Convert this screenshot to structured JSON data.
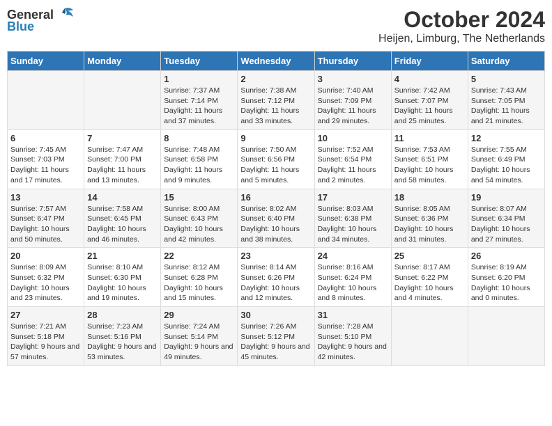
{
  "logo": {
    "general": "General",
    "blue": "Blue"
  },
  "title": "October 2024",
  "location": "Heijen, Limburg, The Netherlands",
  "days_of_week": [
    "Sunday",
    "Monday",
    "Tuesday",
    "Wednesday",
    "Thursday",
    "Friday",
    "Saturday"
  ],
  "weeks": [
    [
      {
        "day": "",
        "info": ""
      },
      {
        "day": "",
        "info": ""
      },
      {
        "day": "1",
        "info": "Sunrise: 7:37 AM\nSunset: 7:14 PM\nDaylight: 11 hours and 37 minutes."
      },
      {
        "day": "2",
        "info": "Sunrise: 7:38 AM\nSunset: 7:12 PM\nDaylight: 11 hours and 33 minutes."
      },
      {
        "day": "3",
        "info": "Sunrise: 7:40 AM\nSunset: 7:09 PM\nDaylight: 11 hours and 29 minutes."
      },
      {
        "day": "4",
        "info": "Sunrise: 7:42 AM\nSunset: 7:07 PM\nDaylight: 11 hours and 25 minutes."
      },
      {
        "day": "5",
        "info": "Sunrise: 7:43 AM\nSunset: 7:05 PM\nDaylight: 11 hours and 21 minutes."
      }
    ],
    [
      {
        "day": "6",
        "info": "Sunrise: 7:45 AM\nSunset: 7:03 PM\nDaylight: 11 hours and 17 minutes."
      },
      {
        "day": "7",
        "info": "Sunrise: 7:47 AM\nSunset: 7:00 PM\nDaylight: 11 hours and 13 minutes."
      },
      {
        "day": "8",
        "info": "Sunrise: 7:48 AM\nSunset: 6:58 PM\nDaylight: 11 hours and 9 minutes."
      },
      {
        "day": "9",
        "info": "Sunrise: 7:50 AM\nSunset: 6:56 PM\nDaylight: 11 hours and 5 minutes."
      },
      {
        "day": "10",
        "info": "Sunrise: 7:52 AM\nSunset: 6:54 PM\nDaylight: 11 hours and 2 minutes."
      },
      {
        "day": "11",
        "info": "Sunrise: 7:53 AM\nSunset: 6:51 PM\nDaylight: 10 hours and 58 minutes."
      },
      {
        "day": "12",
        "info": "Sunrise: 7:55 AM\nSunset: 6:49 PM\nDaylight: 10 hours and 54 minutes."
      }
    ],
    [
      {
        "day": "13",
        "info": "Sunrise: 7:57 AM\nSunset: 6:47 PM\nDaylight: 10 hours and 50 minutes."
      },
      {
        "day": "14",
        "info": "Sunrise: 7:58 AM\nSunset: 6:45 PM\nDaylight: 10 hours and 46 minutes."
      },
      {
        "day": "15",
        "info": "Sunrise: 8:00 AM\nSunset: 6:43 PM\nDaylight: 10 hours and 42 minutes."
      },
      {
        "day": "16",
        "info": "Sunrise: 8:02 AM\nSunset: 6:40 PM\nDaylight: 10 hours and 38 minutes."
      },
      {
        "day": "17",
        "info": "Sunrise: 8:03 AM\nSunset: 6:38 PM\nDaylight: 10 hours and 34 minutes."
      },
      {
        "day": "18",
        "info": "Sunrise: 8:05 AM\nSunset: 6:36 PM\nDaylight: 10 hours and 31 minutes."
      },
      {
        "day": "19",
        "info": "Sunrise: 8:07 AM\nSunset: 6:34 PM\nDaylight: 10 hours and 27 minutes."
      }
    ],
    [
      {
        "day": "20",
        "info": "Sunrise: 8:09 AM\nSunset: 6:32 PM\nDaylight: 10 hours and 23 minutes."
      },
      {
        "day": "21",
        "info": "Sunrise: 8:10 AM\nSunset: 6:30 PM\nDaylight: 10 hours and 19 minutes."
      },
      {
        "day": "22",
        "info": "Sunrise: 8:12 AM\nSunset: 6:28 PM\nDaylight: 10 hours and 15 minutes."
      },
      {
        "day": "23",
        "info": "Sunrise: 8:14 AM\nSunset: 6:26 PM\nDaylight: 10 hours and 12 minutes."
      },
      {
        "day": "24",
        "info": "Sunrise: 8:16 AM\nSunset: 6:24 PM\nDaylight: 10 hours and 8 minutes."
      },
      {
        "day": "25",
        "info": "Sunrise: 8:17 AM\nSunset: 6:22 PM\nDaylight: 10 hours and 4 minutes."
      },
      {
        "day": "26",
        "info": "Sunrise: 8:19 AM\nSunset: 6:20 PM\nDaylight: 10 hours and 0 minutes."
      }
    ],
    [
      {
        "day": "27",
        "info": "Sunrise: 7:21 AM\nSunset: 5:18 PM\nDaylight: 9 hours and 57 minutes."
      },
      {
        "day": "28",
        "info": "Sunrise: 7:23 AM\nSunset: 5:16 PM\nDaylight: 9 hours and 53 minutes."
      },
      {
        "day": "29",
        "info": "Sunrise: 7:24 AM\nSunset: 5:14 PM\nDaylight: 9 hours and 49 minutes."
      },
      {
        "day": "30",
        "info": "Sunrise: 7:26 AM\nSunset: 5:12 PM\nDaylight: 9 hours and 45 minutes."
      },
      {
        "day": "31",
        "info": "Sunrise: 7:28 AM\nSunset: 5:10 PM\nDaylight: 9 hours and 42 minutes."
      },
      {
        "day": "",
        "info": ""
      },
      {
        "day": "",
        "info": ""
      }
    ]
  ]
}
